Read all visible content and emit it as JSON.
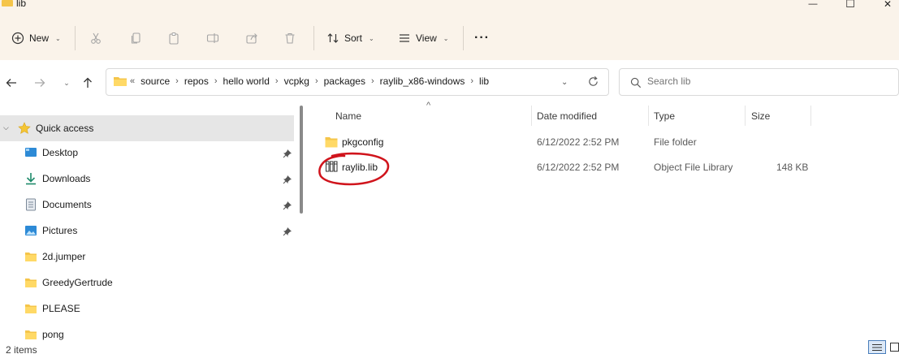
{
  "window": {
    "title": "lib",
    "minimize_glyph": "—",
    "maximize_glyph": "☐",
    "close_glyph": "✕"
  },
  "toolbar": {
    "new_label": "New",
    "sort_label": "Sort",
    "view_label": "View",
    "more_glyph": "···",
    "icons": [
      "plus-icon",
      "cut-icon",
      "copy-icon",
      "paste-icon",
      "rename-icon",
      "share-icon",
      "delete-icon",
      "sort-icon",
      "view-icon",
      "more-icon"
    ]
  },
  "address": {
    "overflow": "«",
    "crumbs": [
      "source",
      "repos",
      "hello world",
      "vcpkg",
      "packages",
      "raylib_x86-windows",
      "lib"
    ]
  },
  "search": {
    "placeholder": "Search lib"
  },
  "sidebar": {
    "items": [
      {
        "label": "Quick access",
        "icon": "star-icon",
        "pinned": false
      },
      {
        "label": "Desktop",
        "icon": "desktop-icon",
        "pinned": true
      },
      {
        "label": "Downloads",
        "icon": "download-icon",
        "pinned": true
      },
      {
        "label": "Documents",
        "icon": "document-icon",
        "pinned": true
      },
      {
        "label": "Pictures",
        "icon": "picture-icon",
        "pinned": true
      },
      {
        "label": "2d.jumper",
        "icon": "folder-icon",
        "pinned": false
      },
      {
        "label": "GreedyGertrude",
        "icon": "folder-icon",
        "pinned": false
      },
      {
        "label": "PLEASE",
        "icon": "folder-icon",
        "pinned": false
      },
      {
        "label": "pong",
        "icon": "folder-icon",
        "pinned": false
      }
    ]
  },
  "filelist": {
    "columns": {
      "name": "Name",
      "date": "Date modified",
      "type": "Type",
      "size": "Size"
    },
    "sort_glyph": "^",
    "rows": [
      {
        "name": "pkgconfig",
        "date": "6/12/2022 2:52 PM",
        "type": "File folder",
        "size": "",
        "icon": "folder-icon"
      },
      {
        "name": "raylib.lib",
        "date": "6/12/2022 2:52 PM",
        "type": "Object File Library",
        "size": "148 KB",
        "icon": "library-file-icon"
      }
    ]
  },
  "status": {
    "items_count": "2 items"
  },
  "colors": {
    "chrome_bg": "#faf3ea",
    "folder_yellow": "#f5c54a",
    "annotation_red": "#d0141c",
    "selection_gray": "#e6e6e6"
  }
}
